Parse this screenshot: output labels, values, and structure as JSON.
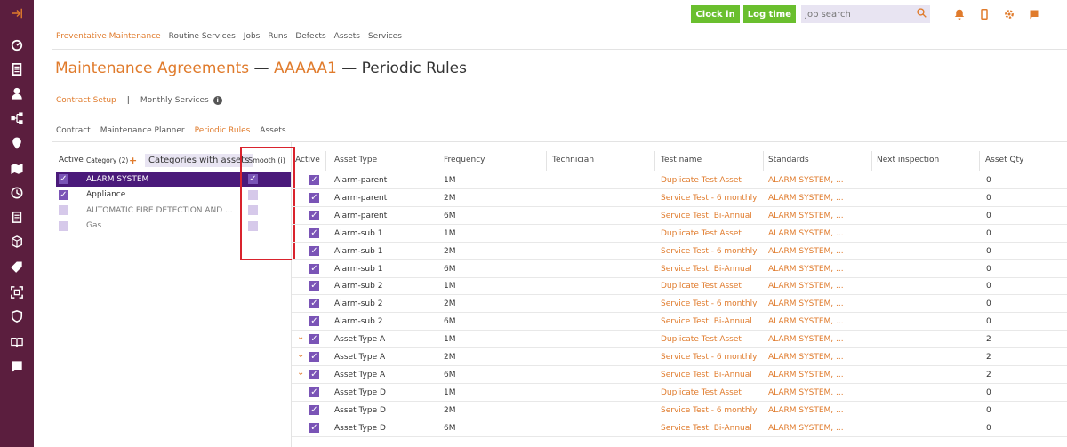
{
  "topbar": {
    "clock_in": "Clock in",
    "log_time": "Log time",
    "search_placeholder": "Job search"
  },
  "nav": [
    "Preventative Maintenance",
    "Routine Services",
    "Jobs",
    "Runs",
    "Defects",
    "Assets",
    "Services"
  ],
  "title": {
    "part1": "Maintenance Agreements",
    "dash1": " — ",
    "part2": "AAAAA1",
    "dash2": " — ",
    "part3": "Periodic Rules"
  },
  "subnav": {
    "contract_setup": "Contract Setup",
    "sep": "|",
    "monthly_services": "Monthly Services",
    "info": "i"
  },
  "tabs": [
    "Contract",
    "Maintenance Planner",
    "Periodic Rules",
    "Assets"
  ],
  "left_panel": {
    "headers": {
      "active": "Active",
      "category": "Category (2)",
      "plus": "+",
      "categories_with_assets": "Categories with assets",
      "smooth": "Smooth (i)"
    },
    "rows": [
      {
        "name": "ALARM SYSTEM",
        "active": true,
        "smooth": true,
        "selected": true
      },
      {
        "name": "Appliance",
        "active": true,
        "smooth": false,
        "selected": false
      },
      {
        "name": "AUTOMATIC FIRE DETECTION AND ...",
        "active": false,
        "smooth": false,
        "selected": false
      },
      {
        "name": "Gas",
        "active": false,
        "smooth": false,
        "selected": false
      }
    ]
  },
  "table": {
    "headers": [
      "Active",
      "Asset Type",
      "Frequency",
      "Technician",
      "Test name",
      "Standards",
      "Next inspection",
      "Asset Qty"
    ],
    "rows": [
      {
        "chev": false,
        "asset_type": "Alarm-parent",
        "frequency": "1M",
        "technician": "",
        "test_name": "Duplicate Test Asset",
        "standards": "ALARM SYSTEM, ...",
        "next_inspection": "",
        "qty": "0"
      },
      {
        "chev": false,
        "asset_type": "Alarm-parent",
        "frequency": "2M",
        "technician": "",
        "test_name": "Service Test - 6 monthly",
        "standards": "ALARM SYSTEM, ...",
        "next_inspection": "",
        "qty": "0"
      },
      {
        "chev": false,
        "asset_type": "Alarm-parent",
        "frequency": "6M",
        "technician": "",
        "test_name": "Service Test: Bi-Annual",
        "standards": "ALARM SYSTEM, ...",
        "next_inspection": "",
        "qty": "0"
      },
      {
        "chev": false,
        "asset_type": "Alarm-sub 1",
        "frequency": "1M",
        "technician": "",
        "test_name": "Duplicate Test Asset",
        "standards": "ALARM SYSTEM, ...",
        "next_inspection": "",
        "qty": "0"
      },
      {
        "chev": false,
        "asset_type": "Alarm-sub 1",
        "frequency": "2M",
        "technician": "",
        "test_name": "Service Test - 6 monthly",
        "standards": "ALARM SYSTEM, ...",
        "next_inspection": "",
        "qty": "0"
      },
      {
        "chev": false,
        "asset_type": "Alarm-sub 1",
        "frequency": "6M",
        "technician": "",
        "test_name": "Service Test: Bi-Annual",
        "standards": "ALARM SYSTEM, ...",
        "next_inspection": "",
        "qty": "0"
      },
      {
        "chev": false,
        "asset_type": "Alarm-sub 2",
        "frequency": "1M",
        "technician": "",
        "test_name": "Duplicate Test Asset",
        "standards": "ALARM SYSTEM, ...",
        "next_inspection": "",
        "qty": "0"
      },
      {
        "chev": false,
        "asset_type": "Alarm-sub 2",
        "frequency": "2M",
        "technician": "",
        "test_name": "Service Test - 6 monthly",
        "standards": "ALARM SYSTEM, ...",
        "next_inspection": "",
        "qty": "0"
      },
      {
        "chev": false,
        "asset_type": "Alarm-sub 2",
        "frequency": "6M",
        "technician": "",
        "test_name": "Service Test: Bi-Annual",
        "standards": "ALARM SYSTEM, ...",
        "next_inspection": "",
        "qty": "0"
      },
      {
        "chev": true,
        "asset_type": "Asset Type A",
        "frequency": "1M",
        "technician": "",
        "test_name": "Duplicate Test Asset",
        "standards": "ALARM SYSTEM, ...",
        "next_inspection": "",
        "qty": "2"
      },
      {
        "chev": true,
        "asset_type": "Asset Type A",
        "frequency": "2M",
        "technician": "",
        "test_name": "Service Test - 6 monthly",
        "standards": "ALARM SYSTEM, ...",
        "next_inspection": "",
        "qty": "2"
      },
      {
        "chev": true,
        "asset_type": "Asset Type A",
        "frequency": "6M",
        "technician": "",
        "test_name": "Service Test: Bi-Annual",
        "standards": "ALARM SYSTEM, ...",
        "next_inspection": "",
        "qty": "2"
      },
      {
        "chev": false,
        "asset_type": "Asset Type D",
        "frequency": "1M",
        "technician": "",
        "test_name": "Duplicate Test Asset",
        "standards": "ALARM SYSTEM, ...",
        "next_inspection": "",
        "qty": "0"
      },
      {
        "chev": false,
        "asset_type": "Asset Type D",
        "frequency": "2M",
        "technician": "",
        "test_name": "Service Test - 6 monthly",
        "standards": "ALARM SYSTEM, ...",
        "next_inspection": "",
        "qty": "0"
      },
      {
        "chev": false,
        "asset_type": "Asset Type D",
        "frequency": "6M",
        "technician": "",
        "test_name": "Service Test: Bi-Annual",
        "standards": "ALARM SYSTEM, ...",
        "next_inspection": "",
        "qty": "0"
      }
    ]
  },
  "colors": {
    "sidebar": "#5b1e3e",
    "accent": "#e07b2c",
    "green": "#6abf2e",
    "selected_row": "#4a1a7a",
    "checkbox_on": "#7a54b6",
    "checkbox_off": "#d6c9ea",
    "highlight": "#d9232d"
  },
  "sidebar_icons": [
    "expand-arrow-icon",
    "gauge-icon",
    "document-list-icon",
    "user-icon",
    "hierarchy-icon",
    "location-pin-icon",
    "map-icon",
    "clock-icon",
    "clipboard-icon",
    "box-icon",
    "tag-icon",
    "scan-icon",
    "shield-icon",
    "book-icon",
    "chat-icon"
  ]
}
